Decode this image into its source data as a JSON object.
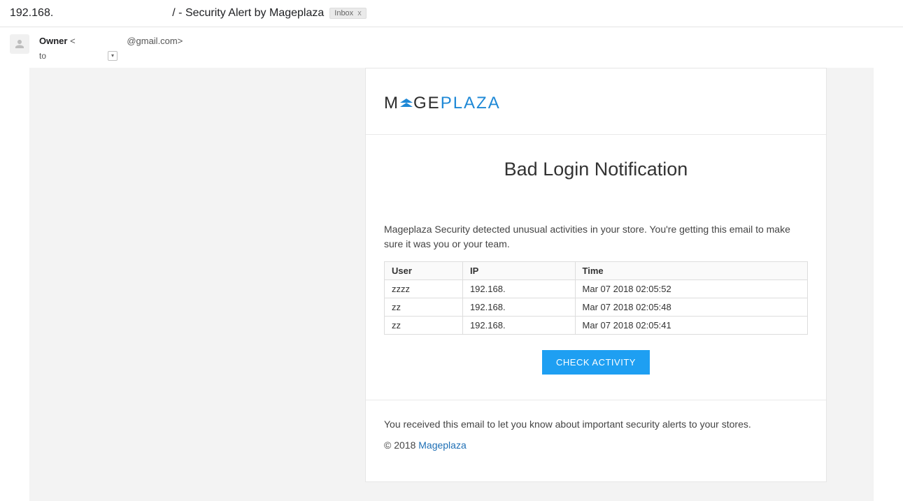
{
  "header": {
    "subject_prefix": "192.168.",
    "subject_main": "/ - Security Alert by Mageplaza",
    "inbox_chip": "Inbox",
    "inbox_close": "x"
  },
  "sender": {
    "name": "Owner",
    "bracket_open": " < ",
    "email_right": "@gmail.com>",
    "to_label": "to"
  },
  "brand": {
    "m": "M",
    "mid": "GE",
    "tail": "PLAZA"
  },
  "content": {
    "title": "Bad Login Notification",
    "desc": "Mageplaza Security detected unusual activities in your store. You're getting this email to make sure it was you or your team.",
    "cta": "CHECK ACTIVITY"
  },
  "table": {
    "headers": {
      "user": "User",
      "ip": "IP",
      "time": "Time"
    },
    "rows": [
      {
        "user": "zzzz",
        "ip": "192.168.",
        "time": "Mar 07 2018 02:05:52"
      },
      {
        "user": "zz",
        "ip": "192.168.",
        "time": "Mar 07 2018 02:05:48"
      },
      {
        "user": "zz",
        "ip": "192.168.",
        "time": "Mar 07 2018 02:05:41"
      }
    ]
  },
  "footer": {
    "note": "You received this email to let you know about important security alerts to your stores.",
    "copyright_prefix": "© 2018 ",
    "link_text": "Mageplaza"
  }
}
